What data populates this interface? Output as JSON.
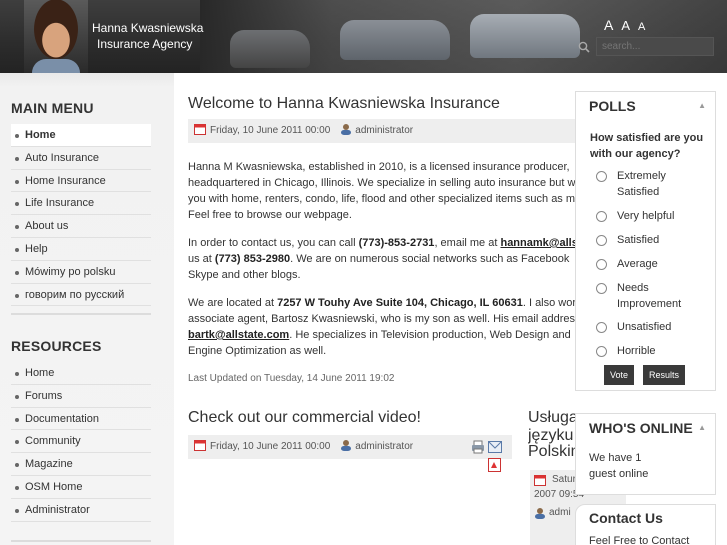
{
  "header": {
    "brand_line1": "Hanna Kwasniewska",
    "brand_line2": "Insurance Agency",
    "font_size_controls": [
      "A",
      "A",
      "A"
    ],
    "search_placeholder": "search..."
  },
  "left": {
    "main_menu_title": "MAIN MENU",
    "main_menu": [
      "Home",
      "Auto Insurance",
      "Home Insurance",
      "Life Insurance",
      "About us",
      "Help",
      "Mówimy po polsku",
      "говорим по русский"
    ],
    "resources_title": "RESOURCES",
    "resources": [
      "Home",
      "Forums",
      "Documentation",
      "Community",
      "Magazine",
      "OSM Home",
      "Administrator"
    ]
  },
  "article1": {
    "title": "Welcome to Hanna Kwasniewska Insurance",
    "date": "Friday, 10 June 2011 00:00",
    "author": "administrator",
    "p1": [
      "Hanna M Kwasniewska, established in 2010, is a licensed insurance producer,",
      "headquartered in Chicago, Illinois. We specialize in selling auto insurance but w",
      "you with home, renters, condo, life, flood and other specialized items such as m",
      "Feel free to browse our webpage."
    ],
    "p2_l1_a": "In order to contact us, you can call ",
    "p2_l1_phone": "(773)-853-2731",
    "p2_l1_b": ", email me at ",
    "p2_l1_email": "hannamk@alls",
    "p2_l2_a": "us at ",
    "p2_l2_phone": "(773) 853-2980",
    "p2_l2_b": ". We are on numerous social networks such as Facebook",
    "p2_l3": "Skype and other blogs.",
    "p3_l1_a": "We are located at ",
    "p3_l1_addr": "7257 W Touhy Ave Suite 104, Chicago, IL 60631",
    "p3_l1_b": ". I also wor",
    "p3_l2": "associate agent, Bartosz Kwasniewski, who is my son as well. His email addres",
    "p3_l3_email": "bartk@allstate.com",
    "p3_l3_b": ". He specializes in Television production, Web Design and",
    "p3_l4": "Engine Optimization as well.",
    "updated": "Last Updated on Tuesday, 14 June 2011 19:02"
  },
  "article2": {
    "title": "Check out our commercial video!",
    "date": "Friday, 10 June 2011 00:00",
    "author": "administrator"
  },
  "article3": {
    "title_lines": [
      "Usługa",
      "języku",
      "Polskim"
    ],
    "date_lines": [
      "Satur",
      "2007 09:54"
    ],
    "author": "admi"
  },
  "polls": {
    "title": "POLLS",
    "question": "How satisfied are you with our agency?",
    "options": [
      "Extremely Satisfied",
      "Very helpful",
      "Satisfied",
      "Average",
      "Needs Improvement",
      "Unsatisfied",
      "Horrible"
    ],
    "vote_label": "Vote",
    "results_label": "Results"
  },
  "whos_online": {
    "title": "WHO'S ONLINE",
    "text": "We have 1 guest online"
  },
  "contact": {
    "title": "Contact Us",
    "text": "Feel Free to Contact"
  }
}
